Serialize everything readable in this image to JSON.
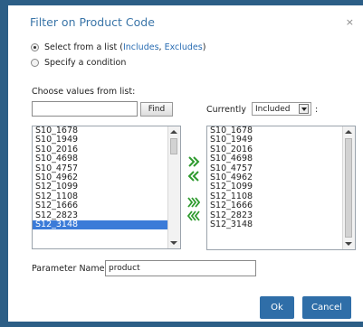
{
  "dialog": {
    "title": "Filter on Product Code",
    "close_glyph": "×"
  },
  "mode": {
    "option_list_label": "Select from a list (",
    "includes_link": "Includes",
    "separator": ", ",
    "excludes_link": "Excludes",
    "closing": ")",
    "option_condition_label": "Specify a condition",
    "selected": "list"
  },
  "available": {
    "label": "Choose values from list:",
    "search_value": "",
    "find_label": "Find",
    "items": [
      "S10_1678",
      "S10_1949",
      "S10_2016",
      "S10_4698",
      "S10_4757",
      "S10_4962",
      "S12_1099",
      "S12_1108",
      "S12_1666",
      "S12_2823",
      "S12_3148"
    ],
    "selected_item": "S12_3148"
  },
  "current": {
    "label": "Currently",
    "mode_value": "Included",
    "colon": ":",
    "items": [
      "S10_1678",
      "S10_1949",
      "S10_2016",
      "S10_4698",
      "S10_4757",
      "S10_4962",
      "S12_1099",
      "S12_1108",
      "S12_1666",
      "S12_2823",
      "S12_3148"
    ]
  },
  "parameter": {
    "label": "Parameter Name:",
    "value": "product"
  },
  "buttons": {
    "ok": "Ok",
    "cancel": "Cancel"
  },
  "colors": {
    "accent": "#2f6ea8",
    "title": "#3a75a8",
    "selection": "#3b7bd8",
    "transfer_arrow": "#2e9a2e",
    "frame": "#2c5e86"
  },
  "icons": {
    "add": "double-chevron-right-icon",
    "remove": "double-chevron-left-icon",
    "add_all": "triple-chevron-right-icon",
    "remove_all": "triple-chevron-left-icon"
  }
}
